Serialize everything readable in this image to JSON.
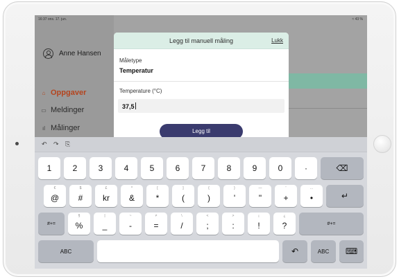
{
  "status_bar": {
    "left": "16:37 ons. 17. jun.",
    "right": "≈ 43 %"
  },
  "user": {
    "name": "Anne Hansen"
  },
  "nav": {
    "items": [
      {
        "label": "Oppgaver",
        "icon": "home-icon"
      },
      {
        "label": "Meldinger",
        "icon": "chat-icon"
      },
      {
        "label": "Målinger",
        "icon": "chart-icon"
      }
    ]
  },
  "modal": {
    "title": "Legg til manuell måling",
    "close_label": "Lukk",
    "type_label": "Måletype",
    "type_value": "Temperatur",
    "input_label": "Temperature (°C)",
    "input_value": "37,5",
    "submit_label": "Legg til"
  },
  "keyboard": {
    "toolbar": [
      "↶",
      "↷",
      "⎘"
    ],
    "row1": [
      "1",
      "2",
      "3",
      "4",
      "5",
      "6",
      "7",
      "8",
      "9",
      "0",
      "·"
    ],
    "row1_delete": "⌫",
    "row2": [
      {
        "sub": "€",
        "main": "@"
      },
      {
        "sub": "$",
        "main": "#"
      },
      {
        "sub": "£",
        "main": "kr"
      },
      {
        "sub": "^",
        "main": "&"
      },
      {
        "sub": "[",
        "main": "*"
      },
      {
        "sub": "]",
        "main": "("
      },
      {
        "sub": "{",
        "main": ")"
      },
      {
        "sub": "}",
        "main": "'"
      },
      {
        "sub": "—",
        "main": "\""
      },
      {
        "sub": "'",
        "main": "+"
      },
      {
        "sub": "…",
        "main": "•"
      }
    ],
    "row2_return": "↵",
    "row3_left": "#+=",
    "row3": [
      {
        "sub": "§",
        "main": "%"
      },
      {
        "sub": "|",
        "main": "_"
      },
      {
        "sub": "~",
        "main": "-"
      },
      {
        "sub": "≠",
        "main": "="
      },
      {
        "sub": "\\",
        "main": "/"
      },
      {
        "sub": "<",
        "main": ";"
      },
      {
        "sub": ">",
        "main": ":"
      },
      {
        "sub": "¡",
        "main": "!"
      },
      {
        "sub": "¿",
        "main": "?"
      }
    ],
    "row3_right": "#+=",
    "row4": {
      "abc_left": "ABC",
      "undo": "↶",
      "abc_right": "ABC",
      "keyboard": "⌨"
    }
  }
}
